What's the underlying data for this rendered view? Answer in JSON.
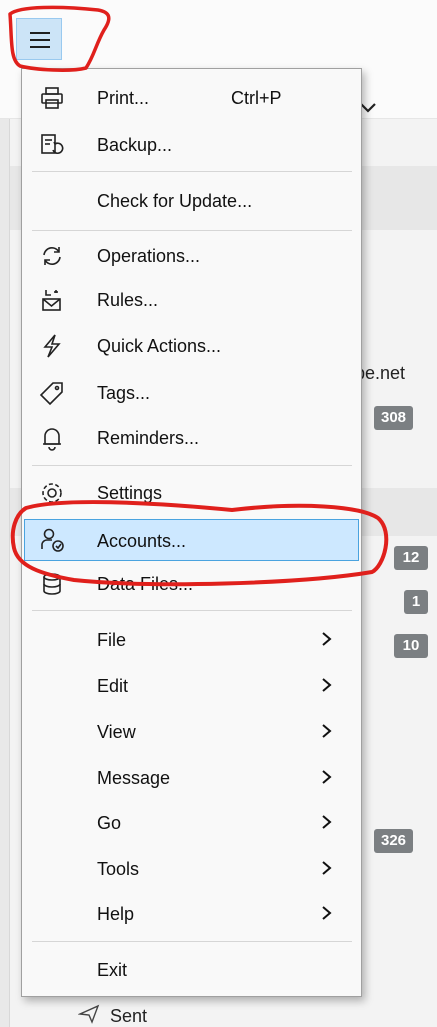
{
  "toolbar": {
    "menu_button_icon": "hamburger-menu-icon"
  },
  "background": {
    "email_fragment": "pe.net",
    "badges": [
      "308",
      "12",
      "1",
      "10",
      "326"
    ],
    "sent_label": "Sent"
  },
  "menu": {
    "print": {
      "label": "Print...",
      "shortcut": "Ctrl+P",
      "icon": "printer-icon"
    },
    "backup": {
      "label": "Backup...",
      "icon": "backup-icon"
    },
    "check_update": {
      "label": "Check for Update..."
    },
    "operations": {
      "label": "Operations...",
      "icon": "sync-icon"
    },
    "rules": {
      "label": "Rules...",
      "icon": "rules-icon"
    },
    "quick_actions": {
      "label": "Quick Actions...",
      "icon": "lightning-icon"
    },
    "tags": {
      "label": "Tags...",
      "icon": "tag-icon"
    },
    "reminders": {
      "label": "Reminders...",
      "icon": "bell-icon"
    },
    "settings": {
      "label": "Settings",
      "icon": "gear-icon"
    },
    "accounts": {
      "label": "Accounts...",
      "icon": "accounts-icon"
    },
    "data_files": {
      "label": "Data Files...",
      "icon": "database-icon"
    },
    "file": {
      "label": "File"
    },
    "edit": {
      "label": "Edit"
    },
    "view": {
      "label": "View"
    },
    "message": {
      "label": "Message"
    },
    "go": {
      "label": "Go"
    },
    "tools": {
      "label": "Tools"
    },
    "help": {
      "label": "Help"
    },
    "exit": {
      "label": "Exit"
    }
  },
  "colors": {
    "highlight_bg": "#cde8ff",
    "highlight_border": "#4aa3df",
    "annotation": "#e0201c",
    "badge": "#7b7f82"
  }
}
